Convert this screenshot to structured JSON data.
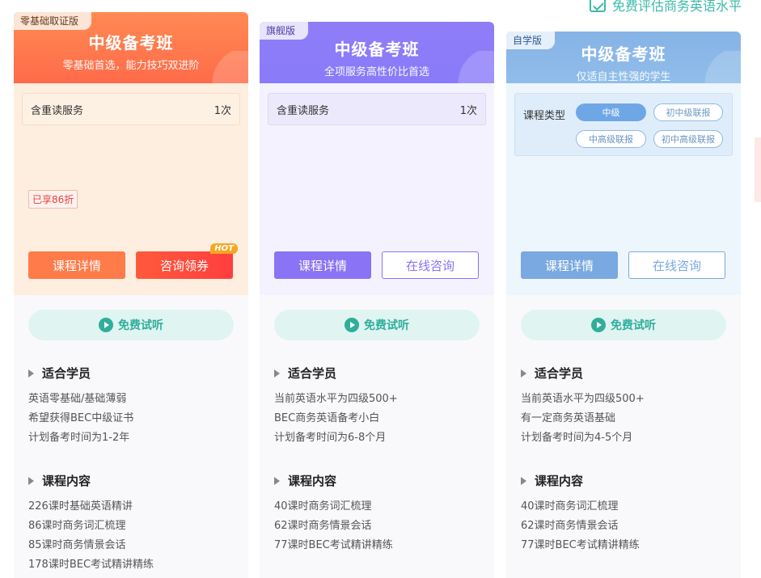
{
  "top_link": "免费评估商务英语水平",
  "colors": {
    "orange": "#ff6b4a",
    "purple": "#8a7bfa",
    "blue": "#86b3e6",
    "teal": "#2fae9c"
  },
  "cards": [
    {
      "tag": "零基础取证版",
      "title": "中级备考班",
      "subtitle": "零基础首选，能力技巧双进阶",
      "service_label": "含重读服务",
      "service_count": "1次",
      "discount": "已享86折",
      "btn_detail": "课程详情",
      "btn_action": "咨询领券",
      "hot": "HOT",
      "trial": "免费试听",
      "audience_title": "适合学员",
      "audience": [
        "英语零基础/基础薄弱",
        "希望获得BEC中级证书",
        "计划备考时间为1-2年"
      ],
      "content_title": "课程内容",
      "content": [
        "226课时基础英语精讲",
        "86课时商务词汇梳理",
        "85课时商务情景会话",
        "178课时BEC考试精讲精练"
      ]
    },
    {
      "tag": "旗舰版",
      "title": "中级备考班",
      "subtitle": "全项服务高性价比首选",
      "service_label": "含重读服务",
      "service_count": "1次",
      "btn_detail": "课程详情",
      "btn_action": "在线咨询",
      "trial": "免费试听",
      "audience_title": "适合学员",
      "audience": [
        "当前英语水平为四级500+",
        "BEC商务英语备考小白",
        "计划备考时间为6-8个月"
      ],
      "content_title": "课程内容",
      "content": [
        "40课时商务词汇梳理",
        "62课时商务情景会话",
        "77课时BEC考试精讲精练"
      ]
    },
    {
      "tag": "自学版",
      "title": "中级备考班",
      "subtitle": "仅适自主性强的学生",
      "type_label": "课程类型",
      "types": [
        "中级",
        "初中级联报",
        "中高级联报",
        "初中高级联报"
      ],
      "selected_type": "中级",
      "btn_detail": "课程详情",
      "btn_action": "在线咨询",
      "trial": "免费试听",
      "audience_title": "适合学员",
      "audience": [
        "当前英语水平为四级500+",
        "有一定商务英语基础",
        "计划备考时间为4-5个月"
      ],
      "content_title": "课程内容",
      "content": [
        "40课时商务词汇梳理",
        "62课时商务情景会话",
        "77课时BEC考试精讲精练"
      ]
    }
  ]
}
